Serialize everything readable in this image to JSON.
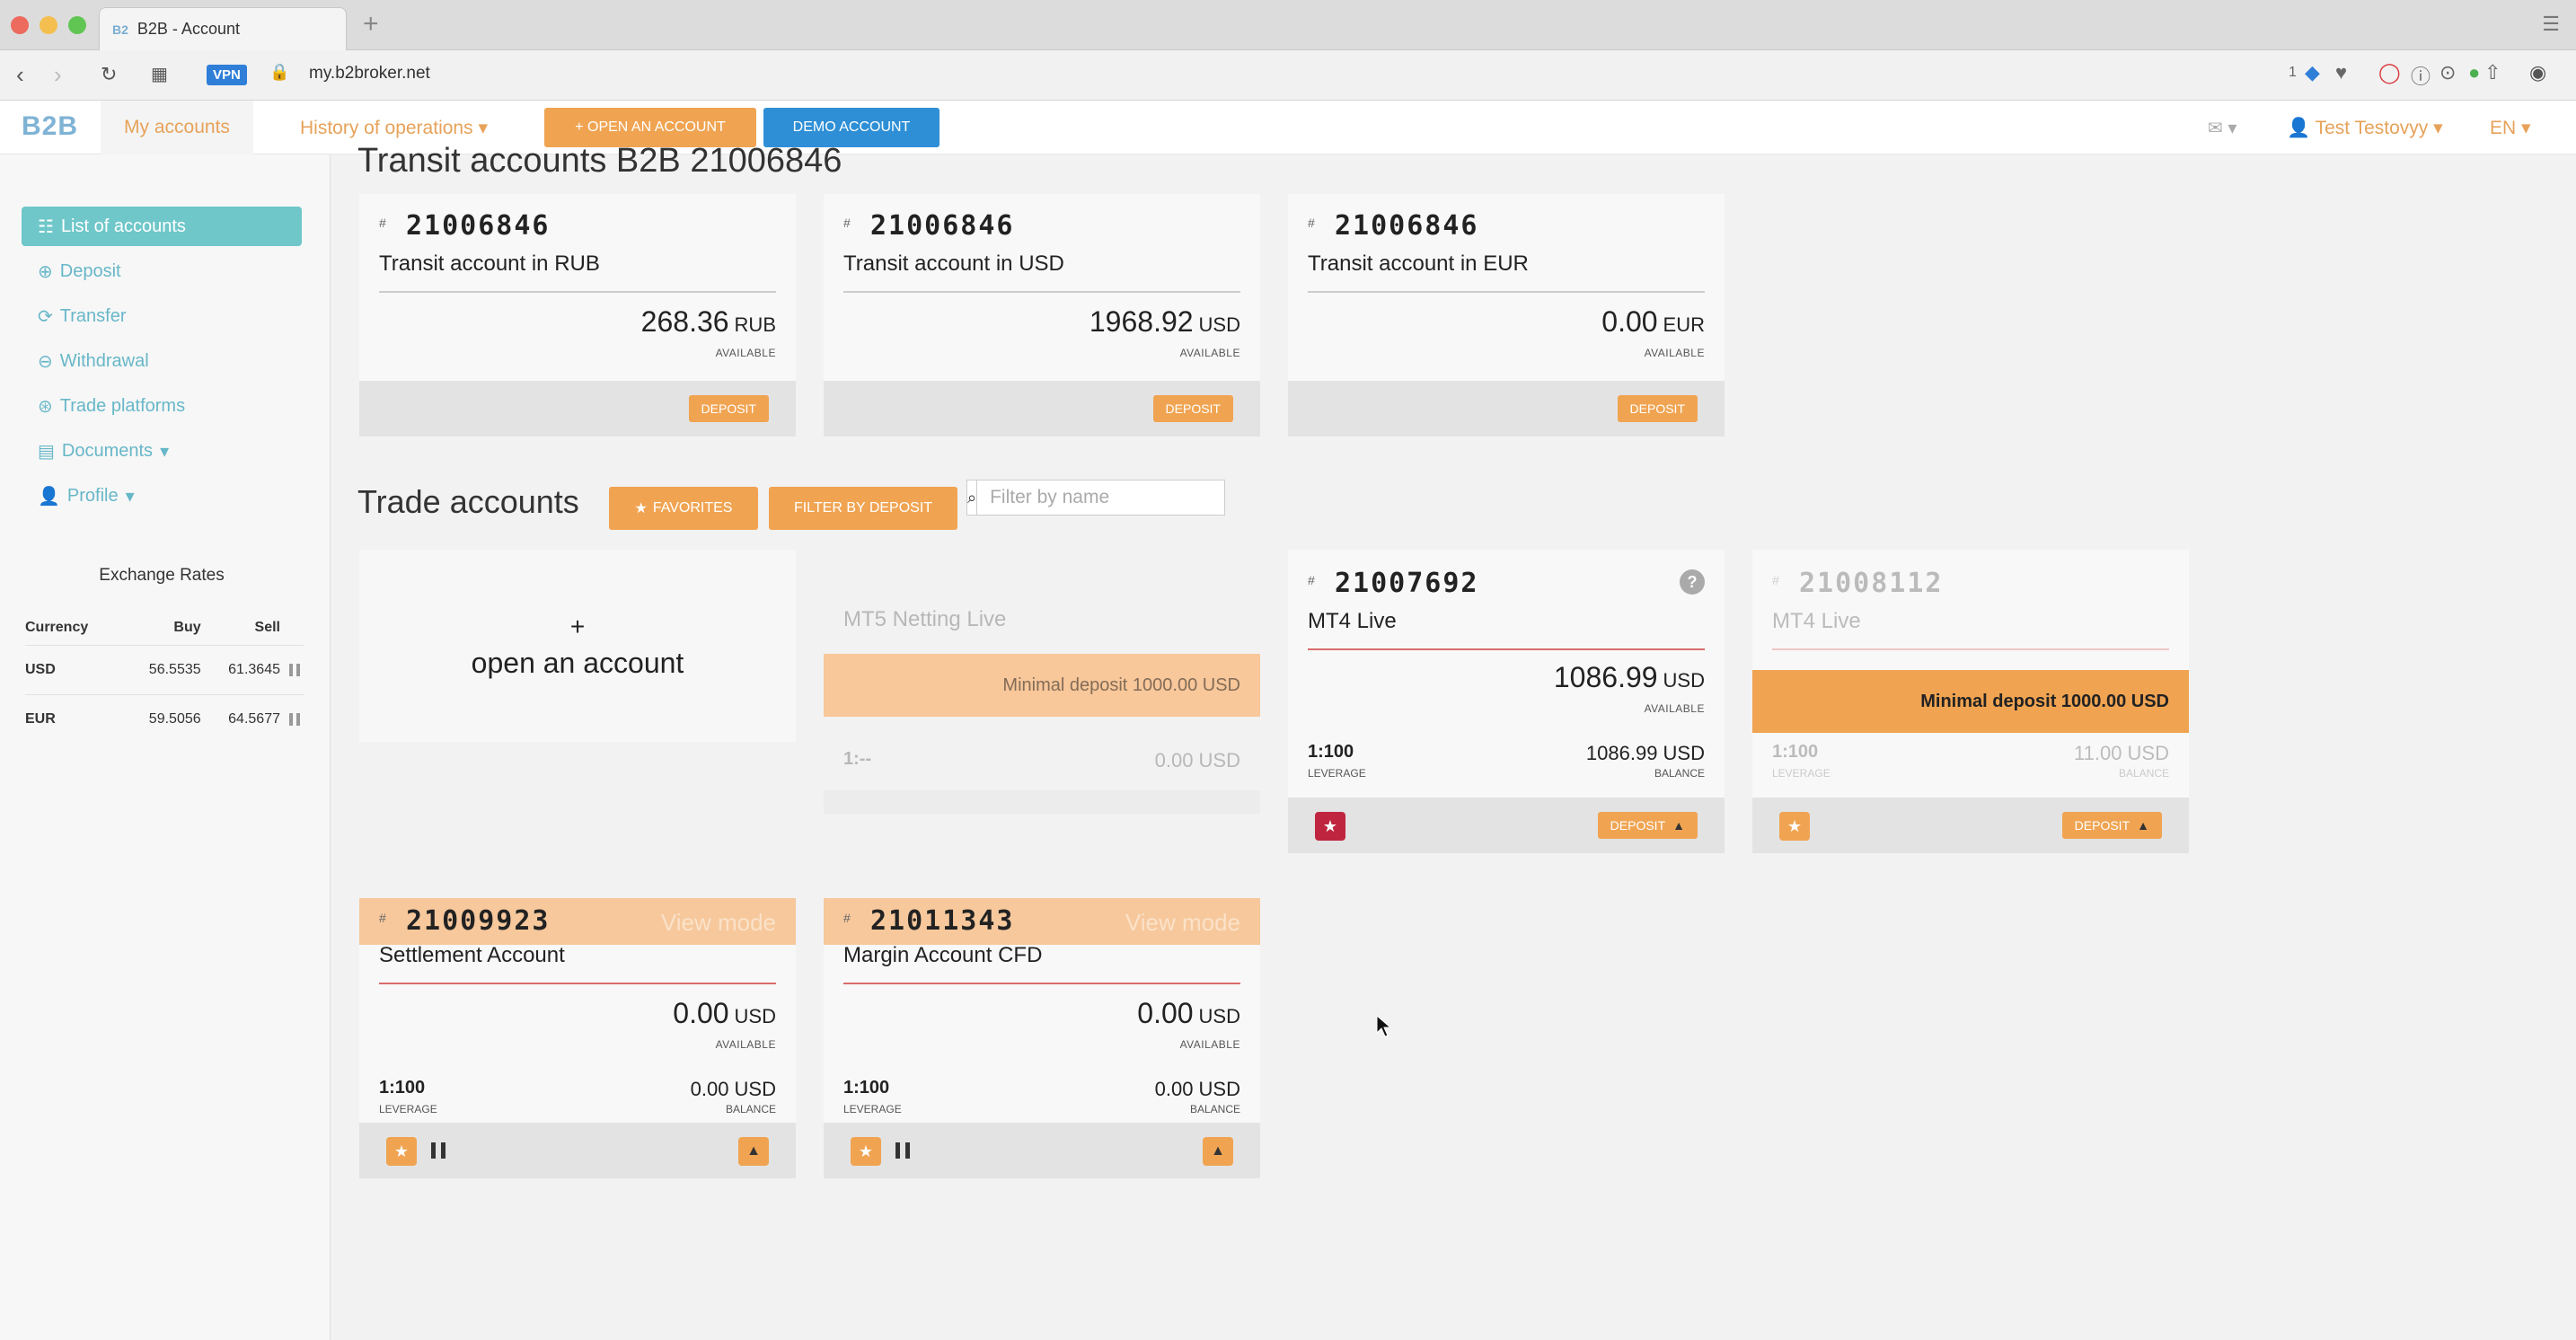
{
  "browser": {
    "tab_title": "B2B - Account",
    "tab_favicon": "B2",
    "new_tab": "+",
    "url": "my.b2broker.net",
    "vpn_label": "VPN",
    "ext_count": "1"
  },
  "header": {
    "logo": "B2B",
    "my_accounts": "My accounts",
    "history": "History of operations",
    "open_account": "+ OPEN AN ACCOUNT",
    "demo_account": "DEMO ACCOUNT",
    "user": "Test Testovyy",
    "lang": "EN"
  },
  "sidebar": {
    "items": [
      {
        "label": "List of accounts",
        "icon": "list-icon"
      },
      {
        "label": "Deposit",
        "icon": "plus-circle-icon"
      },
      {
        "label": "Transfer",
        "icon": "refresh-icon"
      },
      {
        "label": "Withdrawal",
        "icon": "minus-circle-icon"
      },
      {
        "label": "Trade platforms",
        "icon": "download-icon"
      },
      {
        "label": "Documents",
        "icon": "file-icon"
      },
      {
        "label": "Profile",
        "icon": "user-icon"
      }
    ],
    "rates": {
      "title": "Exchange Rates",
      "headers": [
        "Currency",
        "Buy",
        "Sell"
      ],
      "rows": [
        {
          "currency": "USD",
          "buy": "56.5535",
          "sell": "61.3645"
        },
        {
          "currency": "EUR",
          "buy": "59.5056",
          "sell": "64.5677"
        }
      ]
    }
  },
  "transit": {
    "title_cut": "Transit accounts B2B 21006846",
    "cards": [
      {
        "hash": "#",
        "number": "21006846",
        "name": "Transit account in RUB",
        "amount": "268.36",
        "ccy": "RUB",
        "available": "AVAILABLE",
        "button": "DEPOSIT"
      },
      {
        "hash": "#",
        "number": "21006846",
        "name": "Transit account in USD",
        "amount": "1968.92",
        "ccy": "USD",
        "available": "AVAILABLE",
        "button": "DEPOSIT"
      },
      {
        "hash": "#",
        "number": "21006846",
        "name": "Transit account in EUR",
        "amount": "0.00",
        "ccy": "EUR",
        "available": "AVAILABLE",
        "button": "DEPOSIT"
      }
    ]
  },
  "trade": {
    "title": "Trade accounts",
    "favorites": "FAVORITES",
    "filter_deposit": "FILTER BY DEPOSIT",
    "filter_placeholder": "Filter by name",
    "open_plus": "+",
    "open_label": "open an account",
    "mt5": {
      "name": "MT5 Netting Live",
      "min_deposit": "Minimal deposit 1000.00 USD",
      "lev": "1:--",
      "balance": "0.00 USD"
    },
    "mt4a": {
      "hash": "#",
      "number": "21007692",
      "name": "MT4 Live",
      "amount": "1086.99",
      "ccy": "USD",
      "available": "AVAILABLE",
      "leverage": "1:100",
      "leverage_cap": "LEVERAGE",
      "balance": "1086.99 USD",
      "balance_cap": "BALANCE",
      "button": "DEPOSIT",
      "help": "?"
    },
    "mt4b": {
      "hash": "#",
      "number": "21008112",
      "name": "MT4 Live",
      "min_deposit": "Minimal deposit 1000.00 USD",
      "leverage": "1:100",
      "leverage_cap": "LEVERAGE",
      "balance": "11.00 USD",
      "balance_cap": "BALANCE",
      "button": "DEPOSIT"
    },
    "settlement": {
      "hash": "#",
      "number": "21009923",
      "view_mode": "View mode",
      "name": "Settlement Account",
      "amount": "0.00",
      "ccy": "USD",
      "available": "AVAILABLE",
      "leverage": "1:100",
      "leverage_cap": "LEVERAGE",
      "balance": "0.00 USD",
      "balance_cap": "BALANCE"
    },
    "margin": {
      "hash": "#",
      "number": "21011343",
      "view_mode": "View mode",
      "name": "Margin Account CFD",
      "amount": "0.00",
      "ccy": "USD",
      "available": "AVAILABLE",
      "leverage": "1:100",
      "leverage_cap": "LEVERAGE",
      "balance": "0.00 USD",
      "balance_cap": "BALANCE"
    }
  },
  "colors": {
    "accent": "#f0a452",
    "teal": "#6fc7c9",
    "demo_blue": "#2e8fd6",
    "star_red": "#c0253f"
  }
}
